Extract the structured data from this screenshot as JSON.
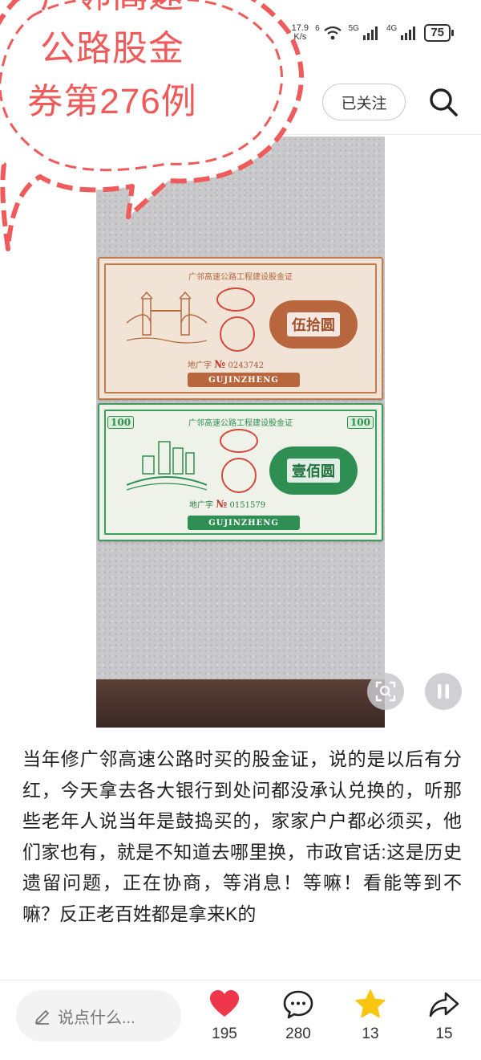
{
  "status": {
    "net_speed_value": "17.9",
    "net_speed_unit": "K/s",
    "wifi_label": "6",
    "sim1_label": "5G",
    "sim2_label": "4G",
    "battery": "75"
  },
  "nav": {
    "follow_label": "已关注"
  },
  "sticker": {
    "line1": "广邻高速",
    "line2": "公路股金",
    "line3": "券第276例"
  },
  "media": {
    "note50": {
      "title": "广邻高速公路工程建设股金证",
      "denomination": "伍拾圆",
      "serial_prefix": "地广字",
      "serial_no": "№",
      "serial": "0243742",
      "ribbon": "GUJINZHENG"
    },
    "note100": {
      "title": "广邻高速公路工程建设股金证",
      "denomination": "壹佰圆",
      "corner": "100",
      "serial_prefix": "地广字",
      "serial_no": "№",
      "serial": "0151579",
      "ribbon": "GUJINZHENG"
    }
  },
  "caption": "当年修广邻高速公路时买的股金证，说的是以后有分红，今天拿去各大银行到处问都没承认兑换的，听那些老年人说当年是鼓捣买的，家家户户都必须买，他们家也有，就是不知道去哪里换，市政官话:这是历史遗留问题，正在协商，等消息！等嘛！看能等到不嘛？反正老百姓都是拿来K的",
  "bottom": {
    "comment_placeholder": "说点什么...",
    "likes": "195",
    "comments": "280",
    "favorites": "13",
    "shares": "15"
  },
  "colors": {
    "like": "#f0364a",
    "star": "#f7c512",
    "sticker": "#ef5a5a"
  }
}
